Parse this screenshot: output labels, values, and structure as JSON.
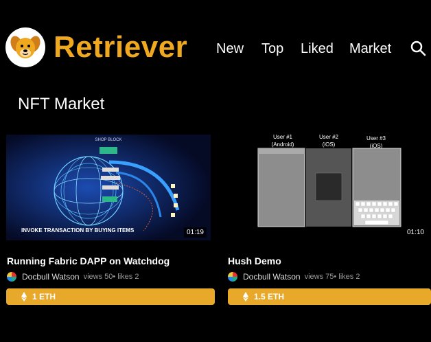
{
  "brand": {
    "name": "Retriever"
  },
  "nav": {
    "items": [
      "New",
      "Top",
      "Liked",
      "Market"
    ]
  },
  "page": {
    "title": "NFT Market"
  },
  "cards": [
    {
      "title": "Running Fabric DAPP on Watchdog",
      "duration": "01:19",
      "author": "Docbull Watson",
      "stats": "views 50• likes 2",
      "price": "1 ETH",
      "thumb_text": {
        "header": "SHOP BLOCK",
        "caption": "INVOKE TRANSACTION BY BUYING ITEMS"
      }
    },
    {
      "title": "Hush Demo",
      "duration": "01:10",
      "author": "Docbull Watson",
      "stats": "views 75• likes 2",
      "price": "1.5 ETH",
      "thumb_text": {
        "users": [
          {
            "name": "User #1",
            "platform": "(Android)"
          },
          {
            "name": "User #2",
            "platform": "(iOS)"
          },
          {
            "name": "User #3",
            "platform": "(iOS)"
          }
        ]
      }
    }
  ],
  "colors": {
    "accent": "#e8a92a",
    "brand": "#f0a81e",
    "background": "#000000"
  }
}
